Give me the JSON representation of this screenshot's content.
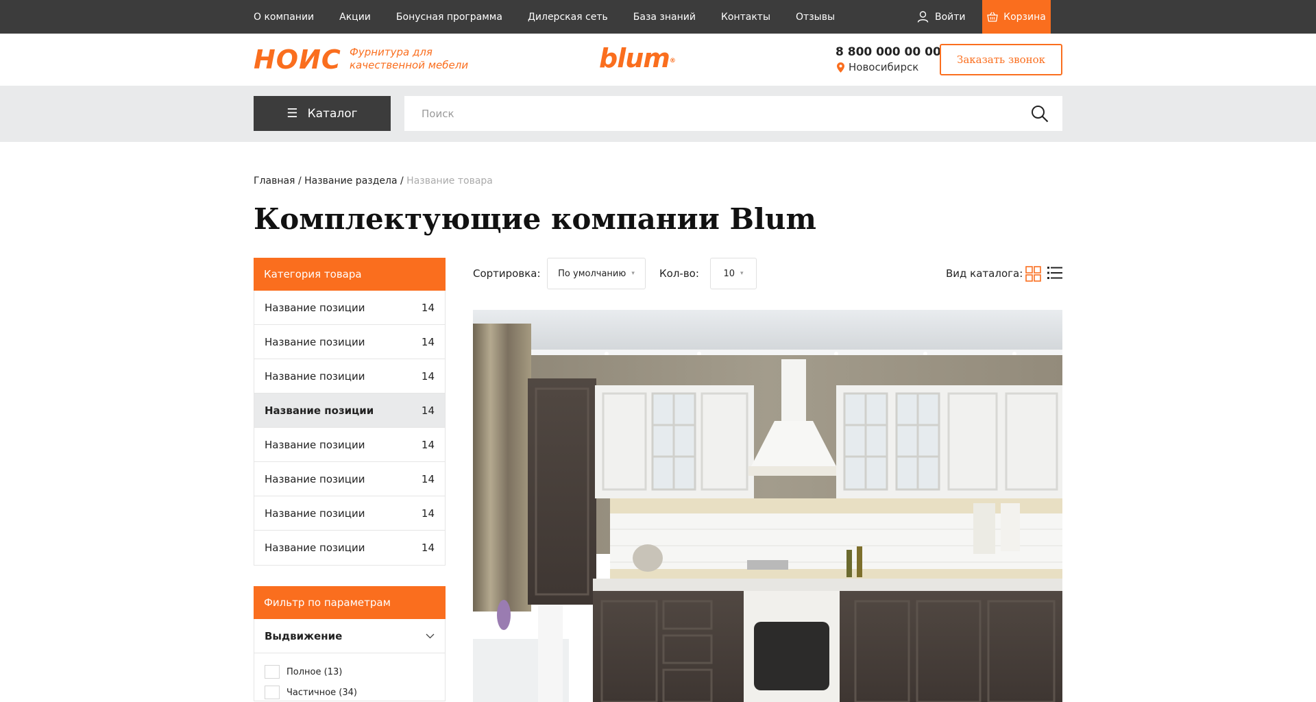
{
  "topnav": {
    "items": [
      "О компании",
      "Акции",
      "Бонусная программа",
      "Дилерская сеть",
      "База знаний",
      "Контакты",
      "Отзывы"
    ],
    "login": "Войти",
    "cart": "Корзина"
  },
  "header": {
    "logo": "НОИС",
    "tagline": "Фурнитура для качественной мебели",
    "brand": "blum",
    "phone": "8 800 000 00 00",
    "city": "Новосибирск",
    "callback": "Заказать звонок"
  },
  "search": {
    "catalog": "Каталог",
    "placeholder": "Поиск"
  },
  "breadcrumb": {
    "home": "Главная",
    "section": "Название раздела",
    "current": "Название товара"
  },
  "page_title": "Комплектующие компании Blum",
  "categories": {
    "title": "Категория товара",
    "items": [
      {
        "label": "Название позиции",
        "count": "14"
      },
      {
        "label": "Название позиции",
        "count": "14"
      },
      {
        "label": "Название позиции",
        "count": "14"
      },
      {
        "label": "Название позиции",
        "count": "14"
      },
      {
        "label": "Название позиции",
        "count": "14"
      },
      {
        "label": "Название позиции",
        "count": "14"
      },
      {
        "label": "Название позиции",
        "count": "14"
      },
      {
        "label": "Название позиции",
        "count": "14"
      }
    ]
  },
  "filter": {
    "title": "Фильтр по параметрам",
    "group": "Выдвижение",
    "options": [
      "Полное (13)",
      "Частичное (34)"
    ]
  },
  "toolbar": {
    "sort_label": "Сортировка:",
    "sort_value": "По умолчанию",
    "qty_label": "Кол-во:",
    "qty_value": "10",
    "view_label": "Вид каталога:"
  },
  "colors": {
    "accent": "#fa6e1e",
    "dark": "#3c3c3c",
    "band": "#e9eaeb"
  }
}
